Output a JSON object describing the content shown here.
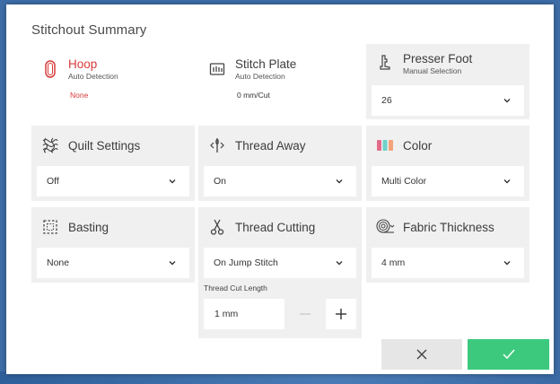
{
  "dialog": {
    "title": "Stitchout Summary"
  },
  "hoop": {
    "title": "Hoop",
    "subtitle": "Auto Detection",
    "value": "None"
  },
  "stitch_plate": {
    "title": "Stitch Plate",
    "subtitle": "Auto Detection",
    "value": "0 mm/Cut"
  },
  "presser_foot": {
    "title": "Presser Foot",
    "subtitle": "Manual Selection",
    "value": "26"
  },
  "quilt_settings": {
    "title": "Quilt Settings",
    "value": "Off"
  },
  "thread_away": {
    "title": "Thread Away",
    "value": "On"
  },
  "color": {
    "title": "Color",
    "value": "Multi Color"
  },
  "basting": {
    "title": "Basting",
    "value": "None"
  },
  "thread_cutting": {
    "title": "Thread Cutting",
    "value": "On Jump Stitch",
    "cut_length_label": "Thread Cut Length",
    "cut_length_value": "1 mm"
  },
  "fabric_thickness": {
    "title": "Fabric Thickness",
    "value": "4 mm"
  },
  "icons": {
    "hoop": "hoop-icon",
    "stitch_plate": "stitch-plate-icon",
    "presser_foot": "presser-foot-icon",
    "quilt": "quilt-icon",
    "thread_away": "thread-away-icon",
    "color": "color-spools-icon",
    "basting": "basting-icon",
    "thread_cutting": "scissors-icon",
    "fabric": "fabric-roll-icon",
    "cancel": "close-icon",
    "confirm": "check-icon"
  },
  "colors": {
    "accent_red": "#d93a3a",
    "confirm_green": "#3cc97e",
    "card_bg": "#f0f0f0",
    "background_blue": "#3f6ea8"
  }
}
